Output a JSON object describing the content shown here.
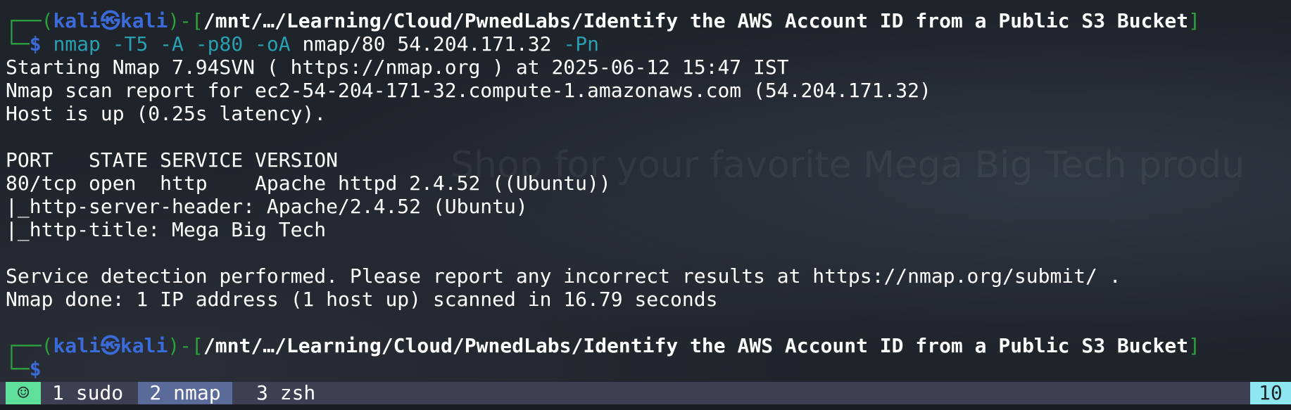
{
  "watermark": "Shop for your favorite Mega Big Tech produ",
  "prompt": {
    "corner_top": "┌──(",
    "user": "kali",
    "at_symbol": "㉿",
    "host": "kali",
    "close_paren": ")-[",
    "path": "/mnt/…/Learning/Cloud/PwnedLabs/Identify the AWS Account ID from a Public S3 Bucket",
    "close_bracket": "]",
    "corner_bottom": "└─",
    "dollar": "$"
  },
  "command": {
    "program": "nmap",
    "flag1": "-T5",
    "flag2": "-A",
    "flag3": "-p80",
    "flag4": "-oA",
    "outfile": "nmap/80",
    "target": "54.204.171.32",
    "flag5": "-Pn"
  },
  "output": [
    "Starting Nmap 7.94SVN ( https://nmap.org ) at 2025-06-12 15:47 IST",
    "Nmap scan report for ec2-54-204-171-32.compute-1.amazonaws.com (54.204.171.32)",
    "Host is up (0.25s latency).",
    "",
    "PORT   STATE SERVICE VERSION",
    "80/tcp open  http    Apache httpd 2.4.52 ((Ubuntu))",
    "|_http-server-header: Apache/2.4.52 (Ubuntu)",
    "|_http-title: Mega Big Tech",
    "",
    "Service detection performed. Please report any incorrect results at https://nmap.org/submit/ .",
    "Nmap done: 1 IP address (1 host up) scanned in 16.79 seconds",
    ""
  ],
  "statusbar": {
    "icon": "☺",
    "tabs": [
      "1 sudo",
      "2 nmap",
      "3 zsh"
    ],
    "right": "10"
  },
  "colors": {
    "prompt_green": "#2e9f3f",
    "prompt_blue": "#3a6bd8",
    "command_cyan": "#29a0b1",
    "active_tab": "#5a6a99",
    "status_icon_bg": "#5ee09a",
    "status_right_bg": "#8ee6f0"
  }
}
